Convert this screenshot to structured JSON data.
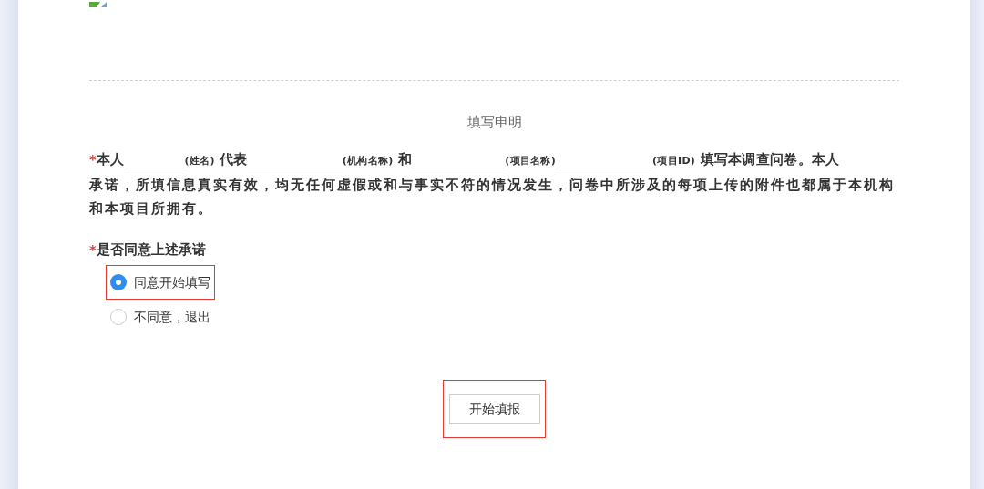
{
  "title": "填写申明",
  "statement": {
    "required_mark": "*",
    "parts": [
      {
        "kind": "text",
        "text": "本人"
      },
      {
        "kind": "blank"
      },
      {
        "kind": "hint",
        "text": "(姓名)"
      },
      {
        "kind": "text",
        "text": " 代表"
      },
      {
        "kind": "blank"
      },
      {
        "kind": "hint",
        "text": "(机构名称)"
      },
      {
        "kind": "text",
        "text": " 和"
      },
      {
        "kind": "blank"
      },
      {
        "kind": "hint",
        "text": "(项目名称)"
      },
      {
        "kind": "blank"
      },
      {
        "kind": "hint",
        "text": "(项目ID)"
      },
      {
        "kind": "text",
        "text": " 填写本调查问卷。本人"
      }
    ],
    "continuation": "承诺，所填信息真实有效，均无任何虚假或和与事实不符的情况发生，问卷中所涉及的每项上传的附件也都属于本机构和本项目所拥有。"
  },
  "question": {
    "label": "是否同意上述承诺",
    "required_mark": "*",
    "options": [
      {
        "label": "同意开始填写",
        "selected": true,
        "highlighted": true
      },
      {
        "label": "不同意，退出",
        "selected": false,
        "highlighted": false
      }
    ]
  },
  "submit": {
    "label": "开始填报",
    "highlighted": true
  }
}
